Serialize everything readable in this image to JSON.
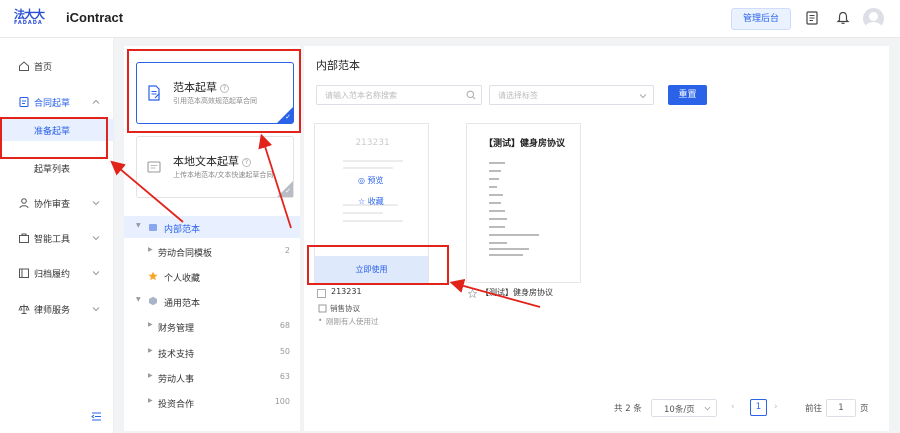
{
  "header": {
    "logo_cn": "法大大",
    "logo_en": "FADADA",
    "app_name": "iContract",
    "admin_button": "管理后台",
    "icons": [
      "document-icon",
      "bell-icon",
      "avatar"
    ]
  },
  "sidebar": {
    "items": [
      {
        "label": "首页",
        "icon": "home-icon"
      },
      {
        "label": "合同起草",
        "icon": "draft-icon"
      },
      {
        "label": "准备起草"
      },
      {
        "label": "起草列表"
      },
      {
        "label": "协作审查",
        "icon": "people-icon"
      },
      {
        "label": "智能工具",
        "icon": "toolbox-icon"
      },
      {
        "label": "归档履约",
        "icon": "archive-icon"
      },
      {
        "label": "律师服务",
        "icon": "scale-icon"
      }
    ]
  },
  "cards": [
    {
      "title": "范本起草",
      "subtitle": "引用范本高效规范起草合同"
    },
    {
      "title": "本地文本起草",
      "subtitle": "上传本地范本/文本快速起草合同"
    }
  ],
  "tree": [
    {
      "label": "内部范本",
      "count": ""
    },
    {
      "label": "劳动合同模板",
      "count": "2"
    },
    {
      "label": "个人收藏",
      "count": ""
    },
    {
      "label": "通用范本",
      "count": ""
    },
    {
      "label": "财务管理",
      "count": "68"
    },
    {
      "label": "技术支持",
      "count": "50"
    },
    {
      "label": "劳动人事",
      "count": "63"
    },
    {
      "label": "投资合作",
      "count": "100"
    }
  ],
  "main": {
    "title": "内部范本",
    "search_placeholder": "请输入范本名称搜索",
    "tag_placeholder": "请选择标签",
    "reset_button": "重置"
  },
  "documents": [
    {
      "preview_number": "213231",
      "preview_action": "预览",
      "favorite_action": "收藏",
      "use_action": "立即使用",
      "name": "213231",
      "tag": "销售协议",
      "usage": "刚刚有人使用过"
    },
    {
      "preview_title": "【测试】健身房协议",
      "name": "【测试】健身房协议"
    }
  ],
  "pagination": {
    "total": "共 2 条",
    "page_size": "10条/页",
    "current": "1",
    "goto_label": "前往",
    "goto_value": "1",
    "goto_unit": "页"
  },
  "colors": {
    "accent": "#2a62e8",
    "annotation": "#e2231a"
  }
}
